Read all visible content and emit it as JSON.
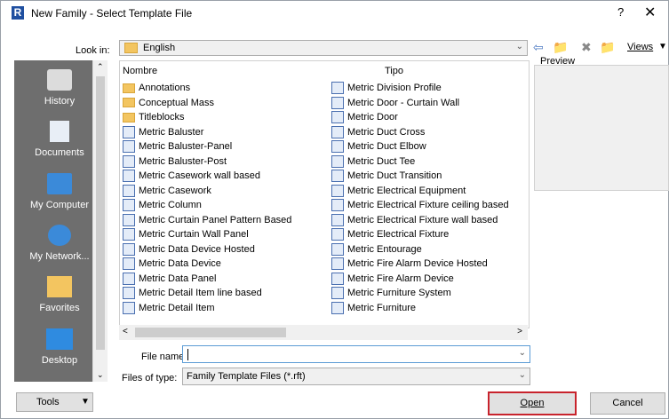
{
  "window": {
    "title": "New Family - Select Template File",
    "app_icon": "R",
    "help": "?",
    "close": "✕"
  },
  "toolbar": {
    "lookin_label": "Look in:",
    "lookin_value": "English",
    "views_label": "Views"
  },
  "places": [
    {
      "label": "History",
      "icon": "history-icon"
    },
    {
      "label": "Documents",
      "icon": "documents-icon"
    },
    {
      "label": "My Computer",
      "icon": "computer-icon"
    },
    {
      "label": "My Network...",
      "icon": "network-icon"
    },
    {
      "label": "Favorites",
      "icon": "favorites-icon"
    },
    {
      "label": "Desktop",
      "icon": "desktop-icon"
    }
  ],
  "list": {
    "col_name": "Nombre",
    "col_type": "Tipo",
    "left": [
      {
        "name": "Annotations",
        "kind": "folder"
      },
      {
        "name": "Conceptual Mass",
        "kind": "folder"
      },
      {
        "name": "Titleblocks",
        "kind": "folder"
      },
      {
        "name": "Metric Baluster",
        "kind": "rft"
      },
      {
        "name": "Metric Baluster-Panel",
        "kind": "rft"
      },
      {
        "name": "Metric Baluster-Post",
        "kind": "rft"
      },
      {
        "name": "Metric Casework wall based",
        "kind": "rft"
      },
      {
        "name": "Metric Casework",
        "kind": "rft"
      },
      {
        "name": "Metric Column",
        "kind": "rft"
      },
      {
        "name": "Metric Curtain Panel Pattern Based",
        "kind": "rft"
      },
      {
        "name": "Metric Curtain Wall Panel",
        "kind": "rft"
      },
      {
        "name": "Metric Data Device Hosted",
        "kind": "rft"
      },
      {
        "name": "Metric Data Device",
        "kind": "rft"
      },
      {
        "name": "Metric Data Panel",
        "kind": "rft"
      },
      {
        "name": "Metric Detail Item line based",
        "kind": "rft"
      },
      {
        "name": "Metric Detail Item",
        "kind": "rft"
      }
    ],
    "right": [
      {
        "name": "Metric Division Profile",
        "kind": "rft"
      },
      {
        "name": "Metric Door - Curtain Wall",
        "kind": "rft"
      },
      {
        "name": "Metric Door",
        "kind": "rft"
      },
      {
        "name": "Metric Duct Cross",
        "kind": "rft"
      },
      {
        "name": "Metric Duct Elbow",
        "kind": "rft"
      },
      {
        "name": "Metric Duct Tee",
        "kind": "rft"
      },
      {
        "name": "Metric Duct Transition",
        "kind": "rft"
      },
      {
        "name": "Metric Electrical Equipment",
        "kind": "rft"
      },
      {
        "name": "Metric Electrical Fixture ceiling based",
        "kind": "rft"
      },
      {
        "name": "Metric Electrical Fixture wall based",
        "kind": "rft"
      },
      {
        "name": "Metric Electrical Fixture",
        "kind": "rft"
      },
      {
        "name": "Metric Entourage",
        "kind": "rft"
      },
      {
        "name": "Metric Fire Alarm Device Hosted",
        "kind": "rft"
      },
      {
        "name": "Metric Fire Alarm Device",
        "kind": "rft"
      },
      {
        "name": "Metric Furniture System",
        "kind": "rft"
      },
      {
        "name": "Metric Furniture",
        "kind": "rft"
      }
    ]
  },
  "preview_label": "Preview",
  "file_name": {
    "label": "File name:",
    "value": ""
  },
  "file_type": {
    "label": "Files of type:",
    "value": "Family Template Files  (*.rft)"
  },
  "buttons": {
    "tools": "Tools",
    "open": "Open",
    "cancel": "Cancel"
  },
  "colors": {
    "places_bg": "#6e6e6e",
    "open_highlight": "#c8232c",
    "folder": "#f3c560"
  }
}
